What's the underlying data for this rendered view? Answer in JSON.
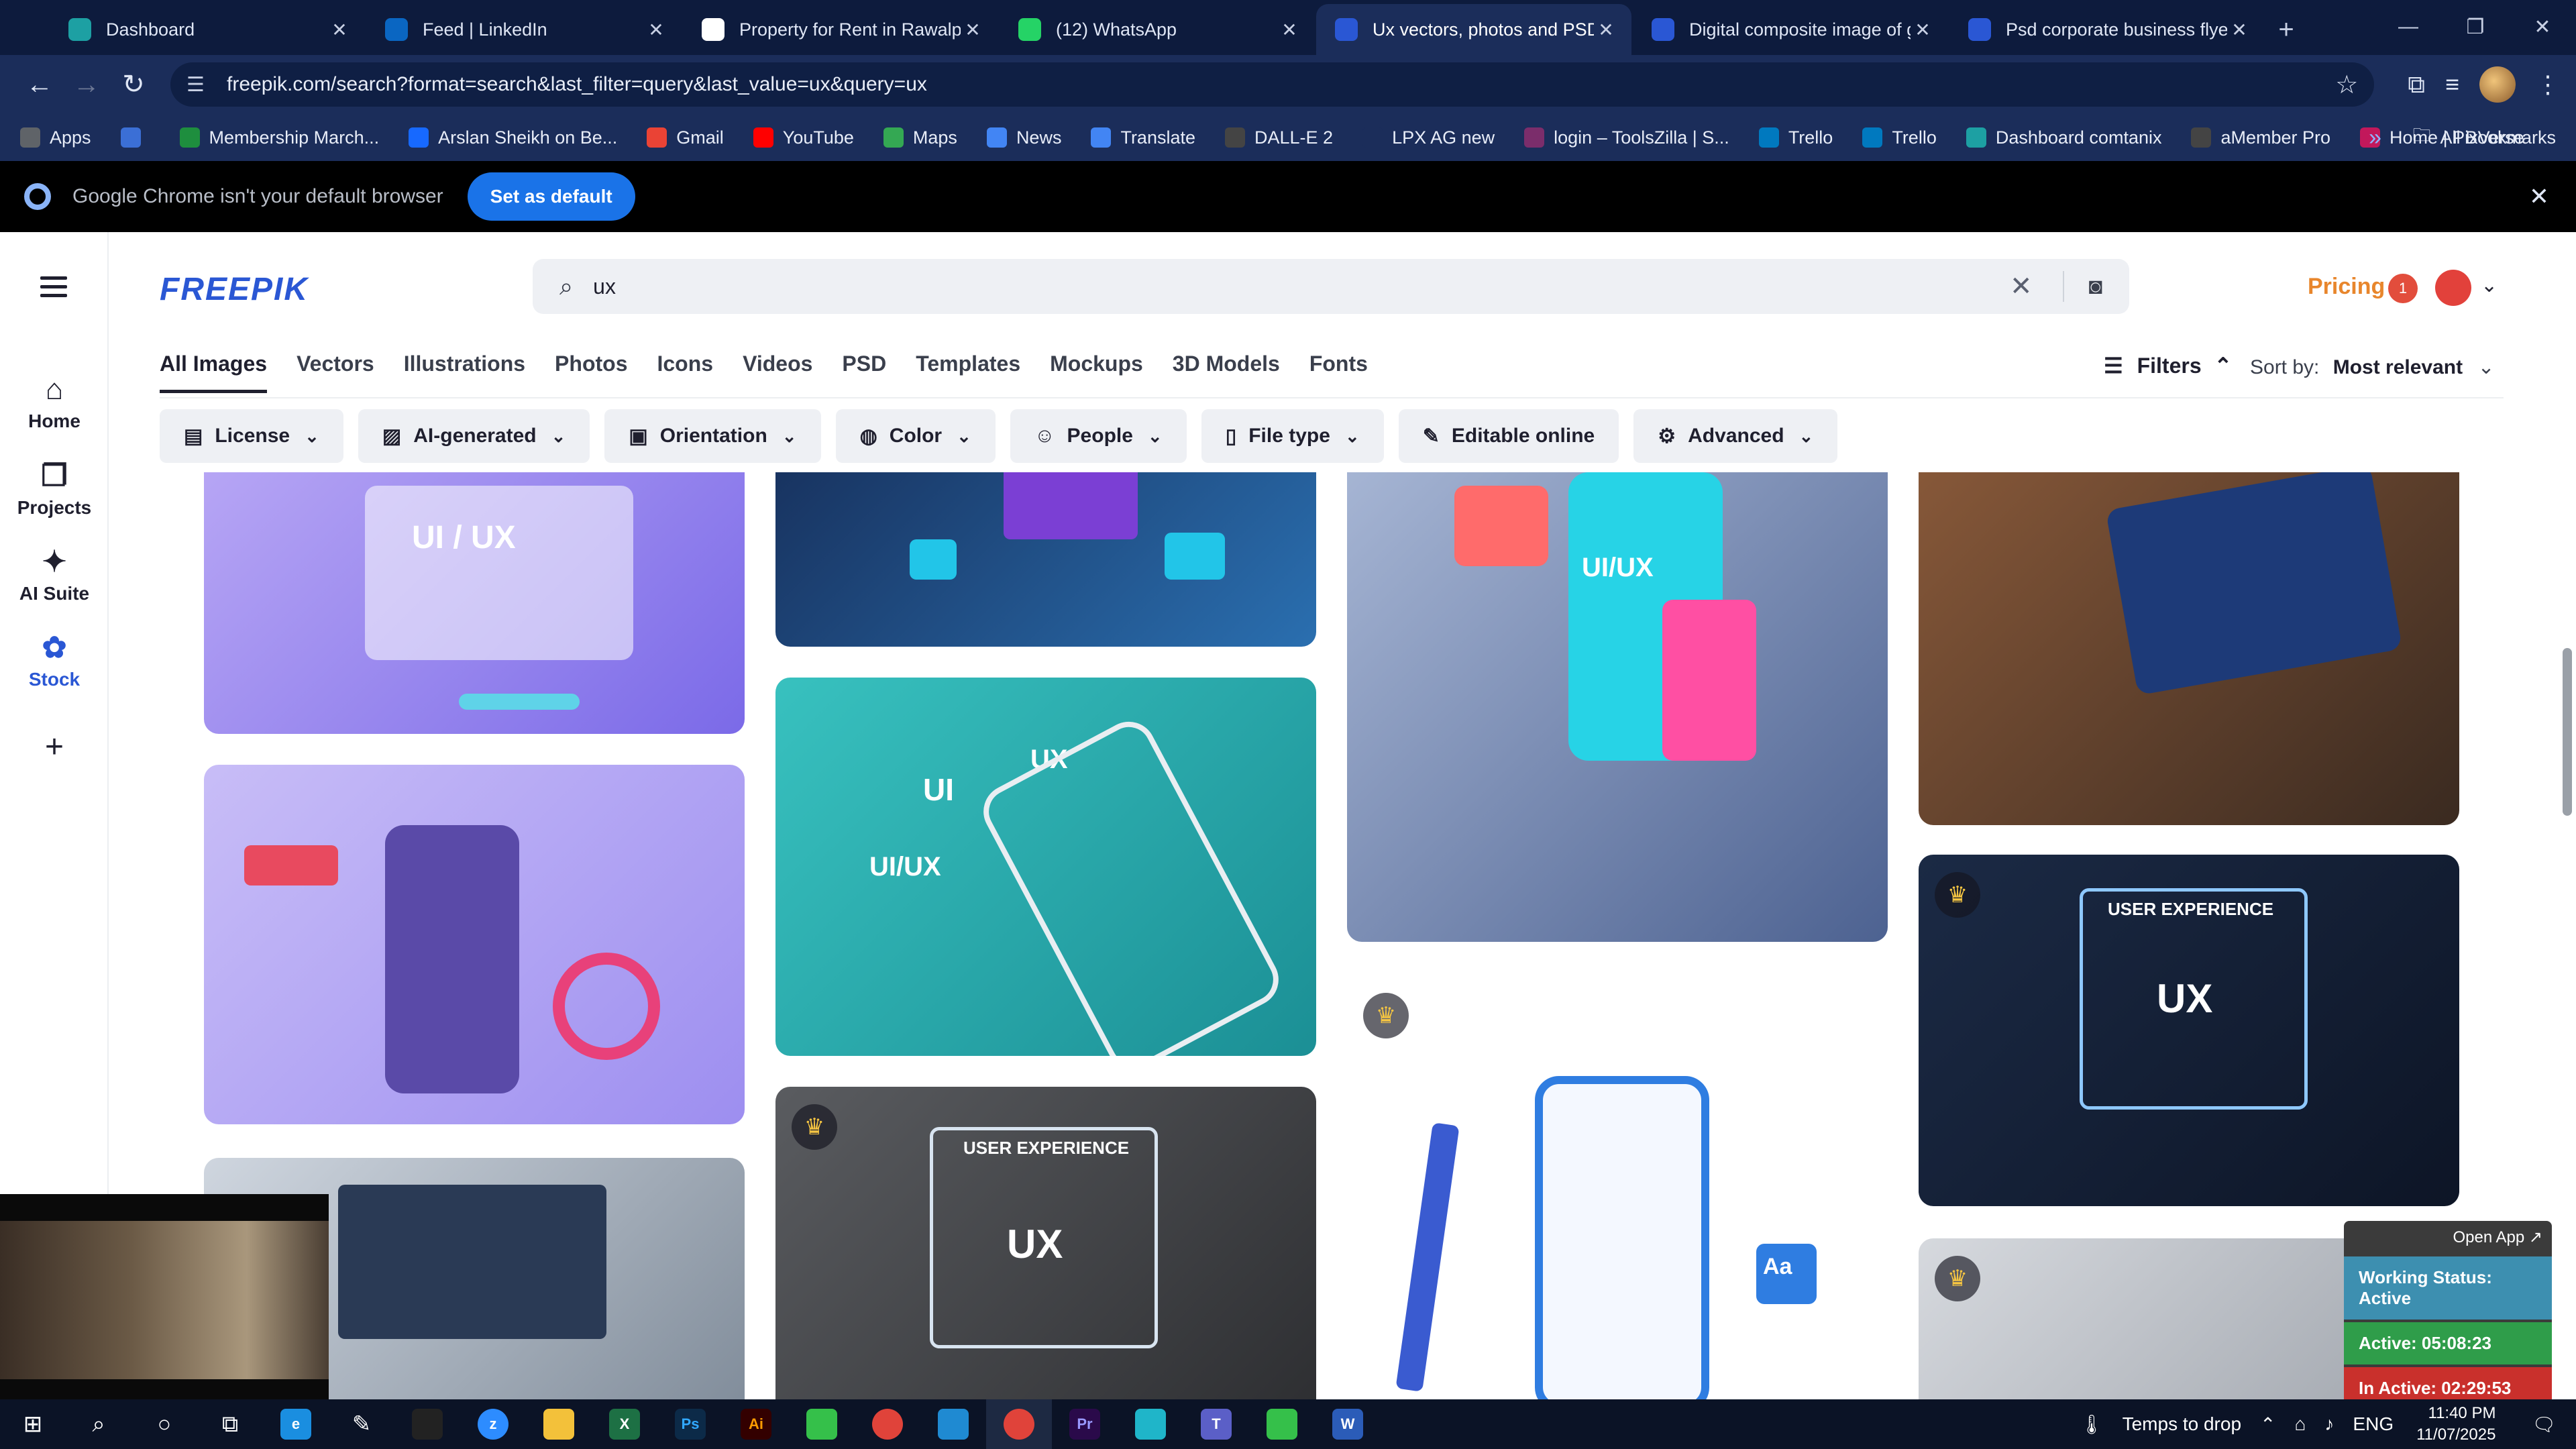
{
  "browser": {
    "tabs": [
      {
        "label": "Dashboard",
        "icon": "dashboard-icon",
        "color": "#1da0a3",
        "active": false
      },
      {
        "label": "Feed | LinkedIn",
        "icon": "linkedin-icon",
        "color": "#0a66c2",
        "active": false
      },
      {
        "label": "Property for Rent in Rawalpindi",
        "icon": "property-icon",
        "color": "#ffffff",
        "active": false
      },
      {
        "label": "(12) WhatsApp",
        "icon": "whatsapp-icon",
        "color": "#25d366",
        "active": false
      },
      {
        "label": "Ux vectors, photos and PSD files",
        "icon": "freepik-icon",
        "color": "#2a57d4",
        "active": true
      },
      {
        "label": "Digital composite image of graphic",
        "icon": "freepik-icon",
        "color": "#2a57d4",
        "active": false
      },
      {
        "label": "Psd corporate business flyer design",
        "icon": "freepik-icon",
        "color": "#2a57d4",
        "active": false
      }
    ],
    "url": "freepik.com/search?format=search&last_filter=query&last_value=ux&query=ux",
    "bookmarks": [
      {
        "label": "Apps",
        "icon": "apps-grid-icon",
        "color": "#5f6368"
      },
      {
        "label": "",
        "icon": "grid-icon",
        "color": "#3b6fd6"
      },
      {
        "label": "Membership March...",
        "icon": "membership-icon",
        "color": "#1e8e3e"
      },
      {
        "label": "Arslan Sheikh on Be...",
        "icon": "behance-icon",
        "color": "#1769ff"
      },
      {
        "label": "Gmail",
        "icon": "gmail-icon",
        "color": "#ea4335"
      },
      {
        "label": "YouTube",
        "icon": "youtube-icon",
        "color": "#ff0000"
      },
      {
        "label": "Maps",
        "icon": "maps-icon",
        "color": "#34a853"
      },
      {
        "label": "News",
        "icon": "news-icon",
        "color": "#4285f4"
      },
      {
        "label": "Translate",
        "icon": "translate-icon",
        "color": "#4285f4"
      },
      {
        "label": "DALL-E 2",
        "icon": "openai-icon",
        "color": "#444444"
      },
      {
        "label": "LPX AG new",
        "icon": "lpx-icon",
        "color": "#1b2d5a"
      },
      {
        "label": "login – ToolsZilla | S...",
        "icon": "toolszilla-icon",
        "color": "#7b2d6b"
      },
      {
        "label": "Trello",
        "icon": "trello-icon",
        "color": "#0079bf"
      },
      {
        "label": "Trello",
        "icon": "trello-icon",
        "color": "#0079bf"
      },
      {
        "label": "Dashboard comtanix",
        "icon": "comtanix-icon",
        "color": "#1da0a3"
      },
      {
        "label": "aMember Pro",
        "icon": "amember-icon",
        "color": "#444444"
      },
      {
        "label": "Home | PixVerse",
        "icon": "pixverse-icon",
        "color": "#c2185b"
      }
    ],
    "all_bookmarks": "All Bookmarks"
  },
  "infobar": {
    "message": "Google Chrome isn't your default browser",
    "button": "Set as default"
  },
  "freepik": {
    "logo": "FREEPIK",
    "search_query": "ux",
    "pricing": "Pricing",
    "notification_count": "1",
    "rail": [
      {
        "label": "Home",
        "icon": "home-icon"
      },
      {
        "label": "Projects",
        "icon": "projects-icon"
      },
      {
        "label": "AI Suite",
        "icon": "ai-sparkle-icon"
      },
      {
        "label": "Stock",
        "icon": "stock-icon",
        "active": true
      }
    ],
    "categories": [
      "All Images",
      "Vectors",
      "Illustrations",
      "Photos",
      "Icons",
      "Videos",
      "PSD",
      "Templates",
      "Mockups",
      "3D Models",
      "Fonts"
    ],
    "filters_label": "Filters",
    "sort_label": "Sort by:",
    "sort_value": "Most relevant",
    "chips": [
      {
        "label": "License",
        "icon": "license-icon"
      },
      {
        "label": "AI-generated",
        "icon": "ai-icon"
      },
      {
        "label": "Orientation",
        "icon": "orientation-icon"
      },
      {
        "label": "Color",
        "icon": "color-icon"
      },
      {
        "label": "People",
        "icon": "people-icon"
      },
      {
        "label": "File type",
        "icon": "file-icon"
      },
      {
        "label": "Editable online",
        "icon": "edit-icon"
      },
      {
        "label": "Advanced",
        "icon": "settings-icon"
      }
    ],
    "image_text": {
      "uiux": "UI / UX",
      "ui": "UI",
      "ux": "UX",
      "uiux2": "UI/UX",
      "phone_uiux": "UI/UX",
      "user_experience": "USER EXPERIENCE"
    }
  },
  "tracker": {
    "open_app": "Open App ↗",
    "working_status": "Working Status: Active",
    "active": "Active: 05:08:23",
    "inactive": "In Active: 02:29:53",
    "colors": {
      "working": "#3d8fb0",
      "active": "#2f9d4a",
      "inactive": "#c9302c"
    }
  },
  "taskbar": {
    "weather": "Temps to drop",
    "language": "ENG",
    "time": "11:40 PM",
    "date": "11/07/2025"
  }
}
